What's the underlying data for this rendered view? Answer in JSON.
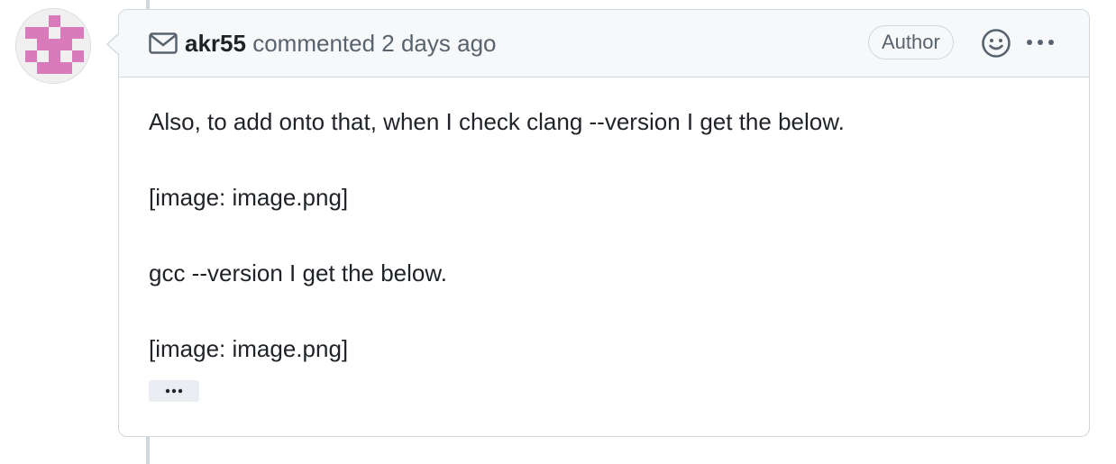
{
  "comment": {
    "author": "akr55",
    "action_text": "commented",
    "timestamp": "2 days ago",
    "author_badge": "Author",
    "paragraphs": [
      "Also, to add onto that, when I check clang --version I get the below.",
      "[image: image.png]",
      "gcc --version I get the below.",
      "[image: image.png]"
    ]
  },
  "icons": {
    "header_icon": "mail-icon",
    "reaction": "smiley-icon",
    "menu": "kebab-horizontal-icon",
    "expand": "ellipsis-icon"
  },
  "colors": {
    "avatar_pink": "#d97bbb",
    "header_bg": "#f6f8fa",
    "border": "#d0d7de",
    "muted_text": "#59636e",
    "text": "#1f2328"
  }
}
